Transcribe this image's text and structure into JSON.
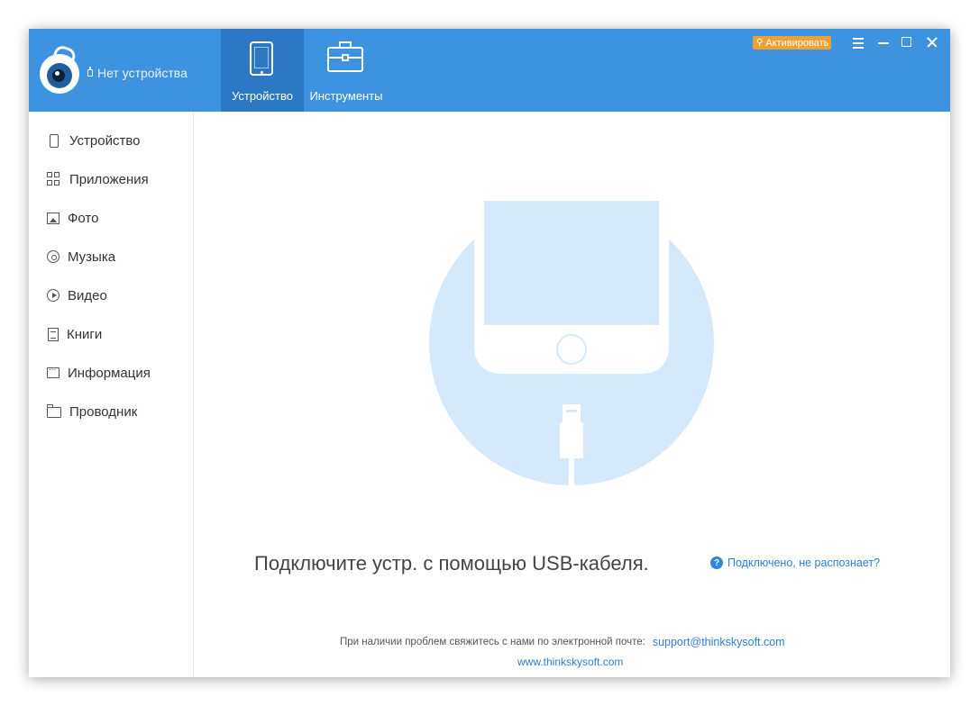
{
  "app": {
    "device_status": "Нет устройства"
  },
  "top_tabs": [
    {
      "label": "Устройство",
      "icon": "phone-icon",
      "active": true
    },
    {
      "label": "Инструменты",
      "icon": "toolbox-icon",
      "active": false
    }
  ],
  "title_bar": {
    "activate_label": "Активировать",
    "activate_color": "#f0a134"
  },
  "sidebar": {
    "items": [
      {
        "label": "Устройство",
        "icon": "device-icon"
      },
      {
        "label": "Приложения",
        "icon": "apps-icon"
      },
      {
        "label": "Фото",
        "icon": "photo-icon"
      },
      {
        "label": "Музыка",
        "icon": "music-icon"
      },
      {
        "label": "Видео",
        "icon": "video-icon"
      },
      {
        "label": "Книги",
        "icon": "books-icon"
      },
      {
        "label": "Информация",
        "icon": "info-icon"
      },
      {
        "label": "Проводник",
        "icon": "folder-icon"
      }
    ]
  },
  "main": {
    "connect_message": "Подключите устр. с помощью USB-кабеля.",
    "help_link": "Подключено, не распознает?",
    "contact_text": "При наличии проблем свяжитесь с нами по электронной почте:",
    "email": "support@thinkskysoft.com",
    "website": "www.thinkskysoft.com"
  },
  "colors": {
    "header": "#3d93df",
    "active_tab": "#2d78c4",
    "link": "#2f7ecf",
    "illustration_circle": "#d6e9fa"
  }
}
